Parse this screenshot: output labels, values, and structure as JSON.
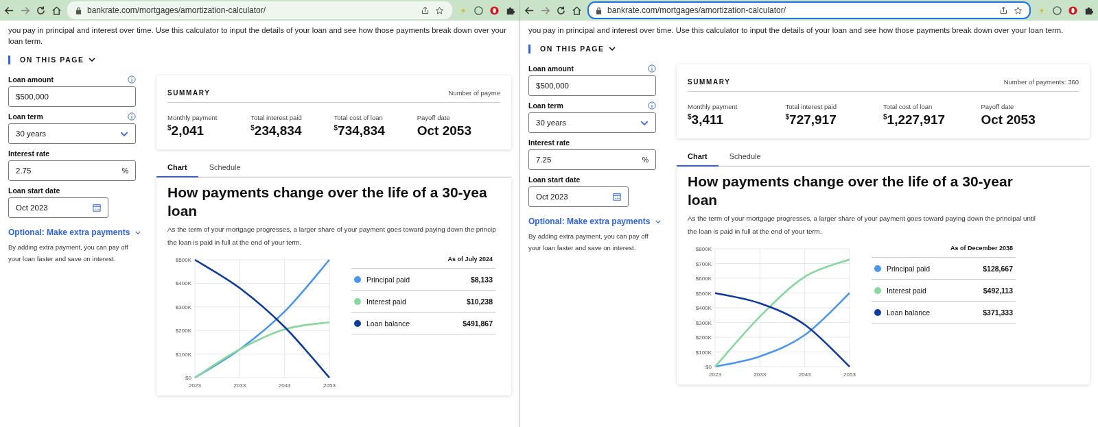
{
  "windows": [
    {
      "address": "bankrate.com/mortgages/amortization-calculator/",
      "address_focused": false,
      "intro": "you pay in principal and interest over time. Use this calculator to input the details of your loan and see how those payments break down over your loan term.",
      "on_this_page": "ON THIS PAGE",
      "fields": [
        {
          "label": "Loan amount",
          "value": "$500,000",
          "kind": "text",
          "info": true
        },
        {
          "label": "Loan term",
          "value": "30 years",
          "kind": "select",
          "info": true
        },
        {
          "label": "Interest rate",
          "value": "2.75",
          "suffix": "%",
          "kind": "text",
          "info": false
        },
        {
          "label": "Loan start date",
          "value": "Oct 2023",
          "kind": "date",
          "info": false
        }
      ],
      "extra_link": "Optional: Make extra payments",
      "extra_note": "By adding extra payment, you can pay off your loan faster and save on interest.",
      "summary": {
        "title": "SUMMARY",
        "payments": "Number of payme",
        "stats": [
          {
            "label": "Monthly payment",
            "currency": "$",
            "value": "2,041"
          },
          {
            "label": "Total interest paid",
            "currency": "$",
            "value": "234,834"
          },
          {
            "label": "Total cost of loan",
            "currency": "$",
            "value": "734,834"
          },
          {
            "label": "Payoff date",
            "value": "Oct 2053"
          }
        ]
      },
      "tabs": [
        {
          "label": "Chart",
          "selected": true
        },
        {
          "label": "Schedule",
          "selected": false
        }
      ],
      "heading": "How payments change over the life of a 30-yea",
      "heading_line2": "loan",
      "description": "As the term of your mortgage progresses, a larger share of your payment goes toward paying down the princip",
      "description_line2": "the loan is paid in full at the end of your term.",
      "chart_data": {
        "type": "line",
        "grid": true,
        "x": [
          2023,
          2033,
          2043,
          2053
        ],
        "xlim": [
          2023,
          2053
        ],
        "xticks": [
          2023,
          2033,
          2043,
          2053
        ],
        "ylim": [
          0,
          500000
        ],
        "yticks": [
          {
            "value": 0,
            "label": "$0"
          },
          {
            "value": 100000,
            "label": "$100K"
          },
          {
            "value": 200000,
            "label": "$200K"
          },
          {
            "value": 300000,
            "label": "$300K"
          },
          {
            "value": 400000,
            "label": "$400K"
          },
          {
            "value": 500000,
            "label": "$500K"
          }
        ],
        "series": [
          {
            "color": "#4a96f0",
            "values": [
              0,
              120000,
              280000,
              500000
            ]
          },
          {
            "color": "#86d99a",
            "values": [
              0,
              120000,
              205000,
              235000
            ]
          },
          {
            "color": "#0f3a9e",
            "values": [
              500000,
              380000,
              215000,
              0
            ]
          }
        ]
      },
      "legend": {
        "as_of": "As of July 2024",
        "items": [
          {
            "name": "Principal paid",
            "color": "#4a96f0",
            "value": "$8,133"
          },
          {
            "name": "Interest paid",
            "color": "#86d99a",
            "value": "$10,238"
          },
          {
            "name": "Loan balance",
            "color": "#0f3a9e",
            "value": "$491,867"
          }
        ]
      }
    },
    {
      "address": "bankrate.com/mortgages/amortization-calculator/",
      "address_focused": true,
      "intro": "you pay in principal and interest over time. Use this calculator to input the details of your loan and see how those payments break down over your loan term.",
      "on_this_page": "ON THIS PAGE",
      "fields": [
        {
          "label": "Loan amount",
          "value": "$500,000",
          "kind": "text",
          "info": true
        },
        {
          "label": "Loan term",
          "value": "30 years",
          "kind": "select",
          "info": true
        },
        {
          "label": "Interest rate",
          "value": "7.25",
          "suffix": "%",
          "kind": "text",
          "info": false
        },
        {
          "label": "Loan start date",
          "value": "Oct 2023",
          "kind": "date",
          "info": false
        }
      ],
      "extra_link": "Optional: Make extra payments",
      "extra_note": "By adding extra payment, you can pay off your loan faster and save on interest.",
      "summary": {
        "title": "SUMMARY",
        "payments": "Number of payments: 360",
        "stats": [
          {
            "label": "Monthly payment",
            "currency": "$",
            "value": "3,411"
          },
          {
            "label": "Total interest paid",
            "currency": "$",
            "value": "727,917"
          },
          {
            "label": "Total cost of loan",
            "currency": "$",
            "value": "1,227,917"
          },
          {
            "label": "Payoff date",
            "value": "Oct 2053"
          }
        ]
      },
      "tabs": [
        {
          "label": "Chart",
          "selected": true
        },
        {
          "label": "Schedule",
          "selected": false
        }
      ],
      "heading": "How payments change over the life of a 30-year",
      "heading_line2": "loan",
      "description": "As the term of your mortgage progresses, a larger share of your payment goes toward paying down the principal until",
      "description_line2": "the loan is paid in full at the end of your term.",
      "chart_data": {
        "type": "line",
        "grid": true,
        "x": [
          2023,
          2033,
          2043,
          2053
        ],
        "xlim": [
          2023,
          2053
        ],
        "xticks": [
          2023,
          2033,
          2043,
          2053
        ],
        "ylim": [
          0,
          800000
        ],
        "yticks": [
          {
            "value": 0,
            "label": "$0"
          },
          {
            "value": 100000,
            "label": "$100K"
          },
          {
            "value": 200000,
            "label": "$200K"
          },
          {
            "value": 300000,
            "label": "$300K"
          },
          {
            "value": 400000,
            "label": "$400K"
          },
          {
            "value": 500000,
            "label": "$500K"
          },
          {
            "value": 600000,
            "label": "$600K"
          },
          {
            "value": 700000,
            "label": "$700K"
          },
          {
            "value": 800000,
            "label": "$800K"
          }
        ],
        "series": [
          {
            "color": "#4a96f0",
            "values": [
              0,
              70000,
              215000,
              500000
            ]
          },
          {
            "color": "#86d99a",
            "values": [
              0,
              340000,
              610000,
              728000
            ]
          },
          {
            "color": "#0f3a9e",
            "values": [
              500000,
              430000,
              285000,
              0
            ]
          }
        ]
      },
      "legend": {
        "as_of": "As of December 2038",
        "items": [
          {
            "name": "Principal paid",
            "color": "#4a96f0",
            "value": "$128,667"
          },
          {
            "name": "Interest paid",
            "color": "#86d99a",
            "value": "$492,113"
          },
          {
            "name": "Loan balance",
            "color": "#0f3a9e",
            "value": "$371,333"
          }
        ]
      }
    }
  ]
}
